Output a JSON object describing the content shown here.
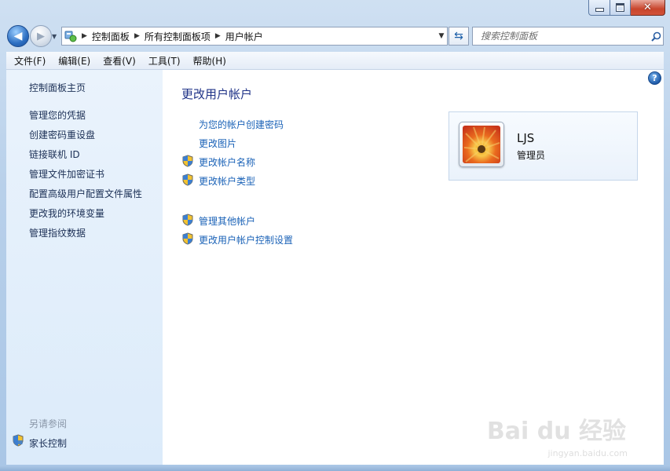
{
  "nav": {
    "breadcrumbs": [
      "控制面板",
      "所有控制面板项",
      "用户帐户"
    ],
    "search_placeholder": "搜索控制面板"
  },
  "menubar": {
    "items": [
      "文件(F)",
      "编辑(E)",
      "查看(V)",
      "工具(T)",
      "帮助(H)"
    ]
  },
  "sidebar": {
    "home": "控制面板主页",
    "links": [
      "管理您的凭据",
      "创建密码重设盘",
      "链接联机 ID",
      "管理文件加密证书",
      "配置高级用户配置文件属性",
      "更改我的环境变量",
      "管理指纹数据"
    ],
    "see_also_label": "另请参阅",
    "parental_controls": "家长控制"
  },
  "main": {
    "title": "更改用户帐户",
    "tasks": [
      "为您的帐户创建密码",
      "更改图片",
      "更改帐户名称",
      "更改帐户类型"
    ],
    "other_tasks": [
      "管理其他帐户",
      "更改用户帐户控制设置"
    ]
  },
  "account": {
    "name": "LJS",
    "role": "管理员"
  },
  "watermark": {
    "brand": "Bai du 经验",
    "url": "jingyan.baidu.com"
  },
  "colors": {
    "link": "#1a62b7",
    "title": "#1e3287",
    "sidebar_bg": "#dcebfa"
  }
}
